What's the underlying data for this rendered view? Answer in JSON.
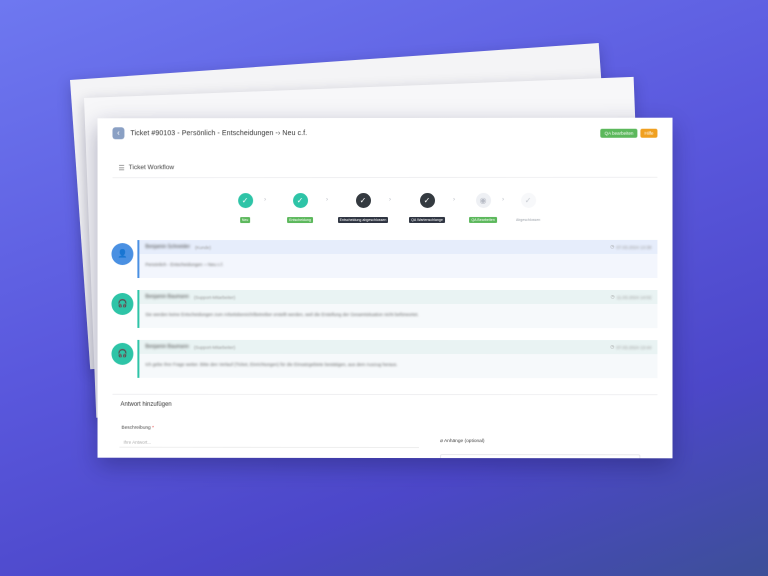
{
  "header": {
    "back_icon": "‹",
    "title": "Ticket #90103 - Persönlich - Entscheidungen -› Neu c.f.",
    "badges": [
      "QA bearbeiten",
      "Hilfe"
    ]
  },
  "workflow": {
    "title": "Ticket Workflow",
    "icon": "list-icon",
    "steps": [
      {
        "label": "Neu",
        "state": "done"
      },
      {
        "label": "Entscheidung",
        "state": "done"
      },
      {
        "label": "Entscheidung abgeschlossen",
        "state": "current"
      },
      {
        "label": "QA Wartenschlange",
        "state": "current"
      },
      {
        "label": "QA Bearbeiten",
        "state": "pending"
      },
      {
        "label": "Abgeschlossen",
        "state": "inactive"
      }
    ]
  },
  "messages": [
    {
      "name": "Benjamin Schneider",
      "role": "(Kunde)",
      "time": "07.03.2024 13:38",
      "text": "Persönlich - Entscheidungen -› Neu c.f.",
      "avatar": "user-icon"
    },
    {
      "name": "Benjamin Baumann",
      "role": "(Support-Mitarbeiter)",
      "time": "11.03.2024 14:02",
      "text": "Sie werden keine Entscheidungen zum Arbeitsbereich/Betreiber erstellt werden, weil die Erstellung der Gesamtsituation nicht befürwortet.",
      "avatar": "agent-icon"
    },
    {
      "name": "Benjamin Baumann",
      "role": "(Support-Mitarbeiter)",
      "time": "07.03.2024 13:44",
      "text": "Ich gebe Ihre Frage weiter. Bitte den Verlauf (Ticket, Einrichtungen) für die Einsatzgebiete bestätigen, aus dem Auszug heraus.",
      "avatar": "agent-icon"
    }
  ],
  "reply": {
    "title": "Antwort hinzufügen",
    "description_label": "Beschreibung",
    "required_mark": "*",
    "description_placeholder": "Ihre Antwort...",
    "attachments_label": "Anhänge (optional)"
  }
}
